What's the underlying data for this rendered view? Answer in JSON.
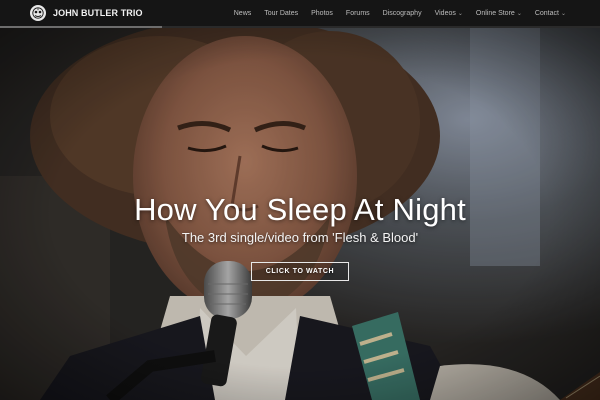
{
  "brand": {
    "name": "JOHN BUTLER TRIO",
    "logo_icon": "band-emblem-icon"
  },
  "nav": {
    "items": [
      {
        "label": "News",
        "has_dropdown": false
      },
      {
        "label": "Tour Dates",
        "has_dropdown": false
      },
      {
        "label": "Photos",
        "has_dropdown": false
      },
      {
        "label": "Forums",
        "has_dropdown": false
      },
      {
        "label": "Discography",
        "has_dropdown": false
      },
      {
        "label": "Videos",
        "has_dropdown": true
      },
      {
        "label": "Online Store",
        "has_dropdown": true
      },
      {
        "label": "Contact",
        "has_dropdown": true
      }
    ],
    "caret": "⌄"
  },
  "hero": {
    "title": "How You Sleep At Night",
    "subtitle": "The 3rd single/video from 'Flesh & Blood'",
    "cta_label": "CLICK TO WATCH",
    "image_subject": "singer-at-microphone-photo"
  },
  "colors": {
    "nav_bg": "#151515",
    "nav_text": "#bdbdbd",
    "brand_text": "#f2f2f2",
    "hero_text": "#ffffff"
  }
}
